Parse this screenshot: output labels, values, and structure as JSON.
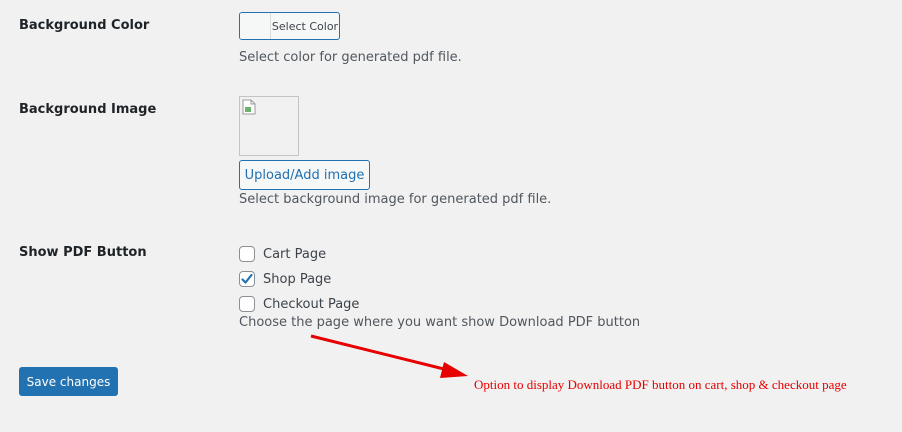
{
  "background_color": {
    "label": "Background Color",
    "button_label": "Select Color",
    "description": "Select color for generated pdf file."
  },
  "background_image": {
    "label": "Background Image",
    "upload_label": "Upload/Add image",
    "description": "Select background image for generated pdf file."
  },
  "show_pdf_button": {
    "label": "Show PDF Button",
    "options": [
      {
        "label": "Cart Page",
        "checked": false
      },
      {
        "label": "Shop Page",
        "checked": true
      },
      {
        "label": "Checkout Page",
        "checked": false
      }
    ],
    "description": "Choose the page where you want show Download PDF button"
  },
  "save_label": "Save changes",
  "annotation": "Option to display Download PDF button on cart, shop & checkout page",
  "colors": {
    "accent": "#2271b1",
    "background": "#f1f1f1",
    "annotation": "#e60000"
  }
}
